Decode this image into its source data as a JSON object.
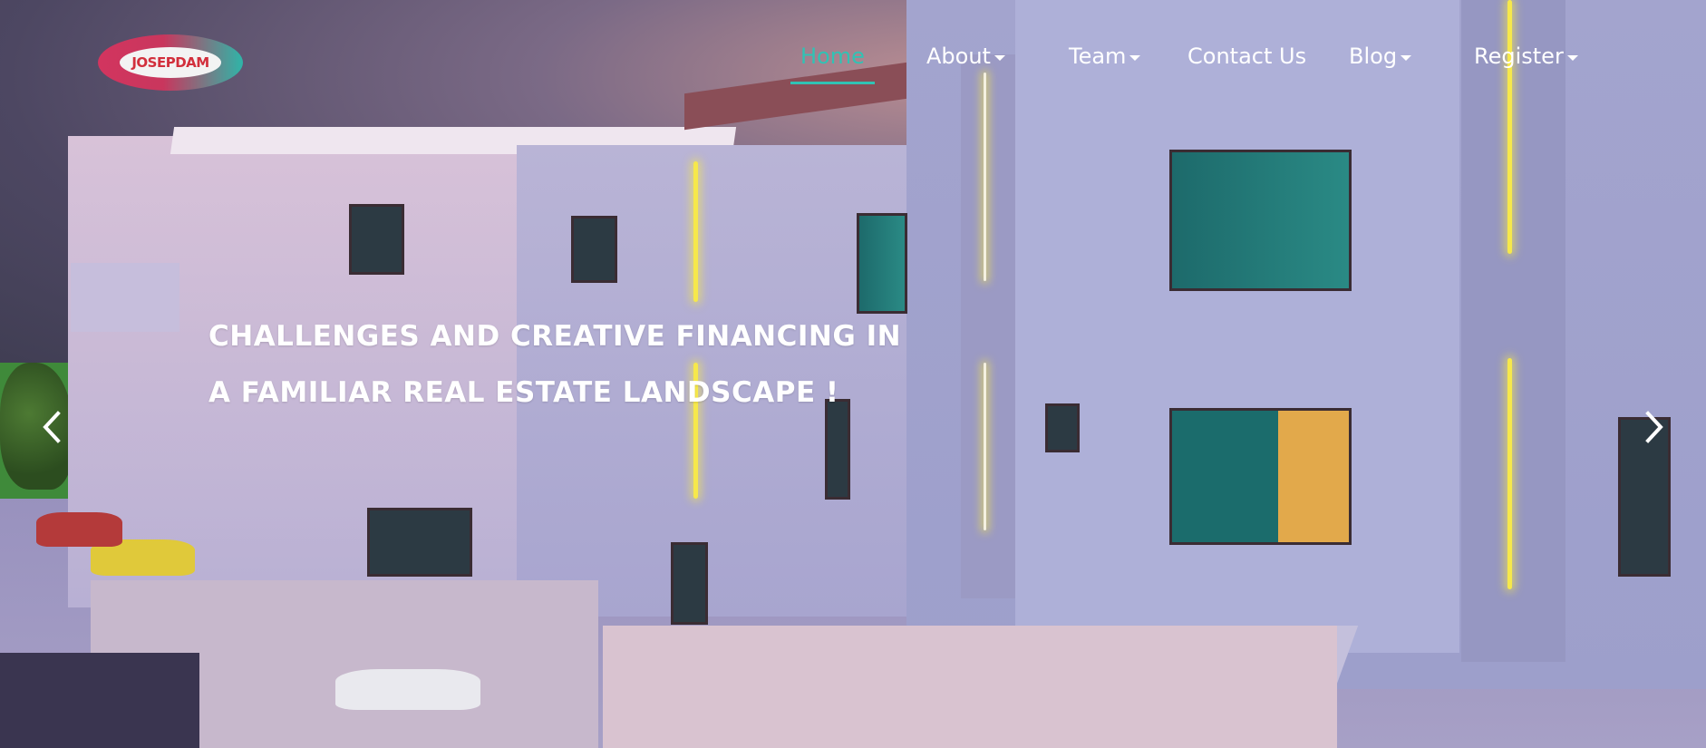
{
  "brand": {
    "logo_text": "JOSEPDAM"
  },
  "nav": {
    "items": [
      {
        "label": "Home",
        "active": true,
        "dropdown": false
      },
      {
        "label": "About",
        "active": false,
        "dropdown": true
      },
      {
        "label": "Team",
        "active": false,
        "dropdown": true
      },
      {
        "label": "Contact Us",
        "active": false,
        "dropdown": false
      },
      {
        "label": "Blog",
        "active": false,
        "dropdown": true
      },
      {
        "label": "Register",
        "active": false,
        "dropdown": true
      }
    ]
  },
  "carousel": {
    "caption_lines": [
      "CHALLENGES AND CREATIVE FINANCING IN",
      "A FAMILIAR REAL ESTATE LANDSCAPE !"
    ],
    "prev_icon": "chevron-left-icon",
    "next_icon": "chevron-right-icon"
  },
  "colors": {
    "accent": "#31c2b4",
    "logo_red": "#d2355f",
    "logo_teal": "#2fb5a8"
  }
}
